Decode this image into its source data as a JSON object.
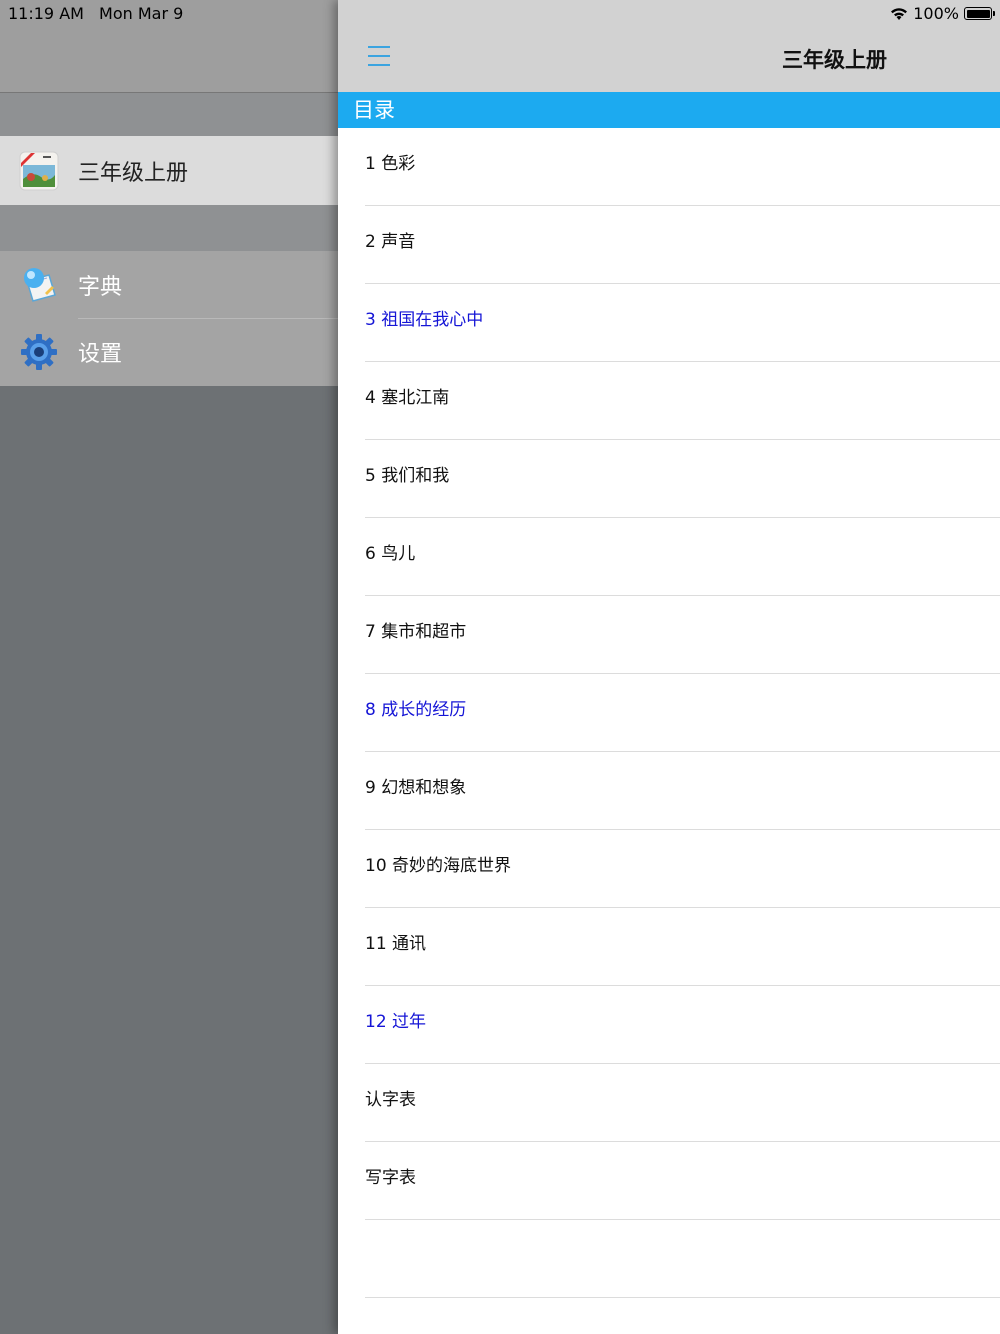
{
  "status_bar": {
    "time": "11:19 AM",
    "date": "Mon Mar 9",
    "battery": "100%",
    "icons": [
      "wifi-icon",
      "battery-icon"
    ]
  },
  "drawer": {
    "book_label": "三年级上册",
    "tools": [
      {
        "label": "字典",
        "icon": "dictionary-icon"
      },
      {
        "label": "设置",
        "icon": "gear-icon"
      }
    ]
  },
  "nav": {
    "title": "三年级上册",
    "menu_icon": "menu-icon"
  },
  "section": {
    "header": "目录"
  },
  "list": {
    "items": [
      {
        "label": "1 色彩",
        "highlight": false
      },
      {
        "label": "2 声音",
        "highlight": false
      },
      {
        "label": "3 祖国在我心中",
        "highlight": true
      },
      {
        "label": "4 塞北江南",
        "highlight": false
      },
      {
        "label": "5 我们和我",
        "highlight": false
      },
      {
        "label": "6 鸟儿",
        "highlight": false
      },
      {
        "label": "7 集市和超市",
        "highlight": false
      },
      {
        "label": "8 成长的经历",
        "highlight": true
      },
      {
        "label": "9 幻想和想象",
        "highlight": false
      },
      {
        "label": "10 奇妙的海底世界",
        "highlight": false
      },
      {
        "label": "11 通讯",
        "highlight": false
      },
      {
        "label": "12 过年",
        "highlight": true
      },
      {
        "label": "认字表",
        "highlight": false
      },
      {
        "label": "写字表",
        "highlight": false
      },
      {
        "label": "",
        "highlight": false
      }
    ]
  },
  "colors": {
    "accent": "#1caaf0",
    "highlight_text": "#1515d6",
    "menu_icon": "#3ba4e0"
  }
}
